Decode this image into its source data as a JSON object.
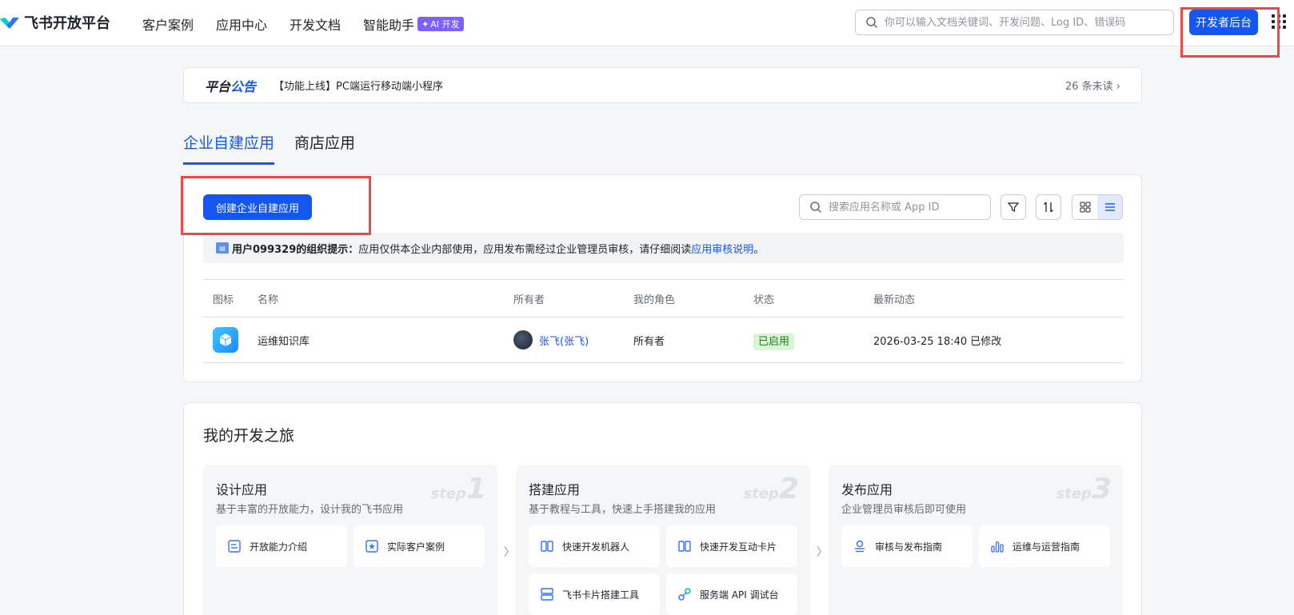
{
  "brand": {
    "name": "飞书开放平台",
    "accent": "#1456f0"
  },
  "nav": {
    "items": [
      "客户案例",
      "应用中心",
      "开发文档",
      "智能助手"
    ],
    "ai_badge": "AI 开发"
  },
  "search": {
    "placeholder": "你可以输入文档关键词、开发问题、Log ID、错误码"
  },
  "header": {
    "dev_console": "开发者后台"
  },
  "notice": {
    "title_a": "平台",
    "title_b": "公告",
    "text": "【功能上线】PC端运行移动端小程序",
    "unread": "26 条未读 ›"
  },
  "tabs": [
    "企业自建应用",
    "商店应用"
  ],
  "apps": {
    "create_label": "创建企业自建应用",
    "search_placeholder": "搜索应用名称或 App ID",
    "tip_prefix": "用户099329的组织提示：",
    "tip_text": "应用仅供本企业内部使用，应用发布需经过企业管理员审核，请仔细阅读 ",
    "tip_link": "应用审核说明",
    "tip_suffix": "。",
    "columns": [
      "图标",
      "名称",
      "所有者",
      "我的角色",
      "状态",
      "最新动态"
    ],
    "rows": [
      {
        "name": "运维知识库",
        "owner": "张飞(张飞)",
        "role": "所有者",
        "status": "已启用",
        "activity": "2026-03-25 18:40 已修改"
      }
    ]
  },
  "journey": {
    "title": "我的开发之旅",
    "steps": [
      {
        "title": "设计应用",
        "desc": "基于丰富的开放能力，设计我的飞书应用",
        "word": "step",
        "num": "1",
        "links": [
          "开放能力介绍",
          "实际客户案例"
        ]
      },
      {
        "title": "搭建应用",
        "desc": "基于教程与工具，快速上手搭建我的应用",
        "word": "step",
        "num": "2",
        "links": [
          "快速开发机器人",
          "快速开发互动卡片",
          "飞书卡片搭建工具",
          "服务端 API 调试台"
        ]
      },
      {
        "title": "发布应用",
        "desc": "企业管理员审核后即可使用",
        "word": "step",
        "num": "3",
        "links": [
          "审核与发布指南",
          "运维与运营指南"
        ]
      }
    ]
  }
}
